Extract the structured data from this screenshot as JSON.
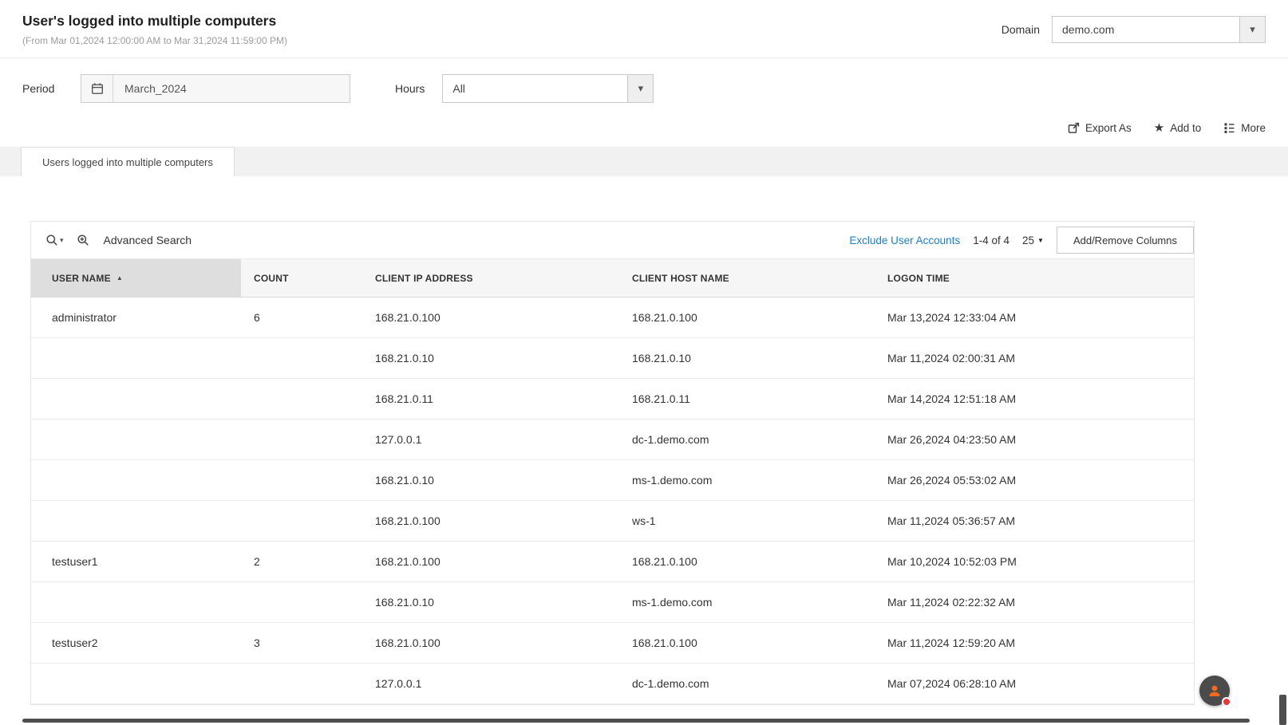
{
  "header": {
    "title": "User's logged into multiple computers",
    "subtitle": "(From Mar 01,2024 12:00:00 AM to Mar 31,2024 11:59:00 PM)",
    "domain_label": "Domain",
    "domain_value": "demo.com"
  },
  "filters": {
    "period_label": "Period",
    "period_value": "March_2024",
    "hours_label": "Hours",
    "hours_value": "All"
  },
  "actions": {
    "export_as": "Export As",
    "add_to": "Add to",
    "more": "More"
  },
  "tabs": [
    {
      "label": "Users logged into multiple computers",
      "active": true
    }
  ],
  "toolbar": {
    "advanced_search": "Advanced Search",
    "exclude_link": "Exclude User Accounts",
    "range_text": "1-4 of 4",
    "page_size": "25",
    "add_remove_columns": "Add/Remove Columns"
  },
  "table": {
    "columns": [
      "USER NAME",
      "COUNT",
      "CLIENT IP ADDRESS",
      "CLIENT HOST NAME",
      "LOGON TIME"
    ],
    "sorted_column": "USER NAME",
    "sort_direction": "asc",
    "rows": [
      [
        "administrator",
        "6",
        "168.21.0.100",
        "168.21.0.100",
        "Mar 13,2024 12:33:04 AM"
      ],
      [
        "",
        "",
        "168.21.0.10",
        "168.21.0.10",
        "Mar 11,2024 02:00:31 AM"
      ],
      [
        "",
        "",
        "168.21.0.11",
        "168.21.0.11",
        "Mar 14,2024 12:51:18 AM"
      ],
      [
        "",
        "",
        "127.0.0.1",
        "dc-1.demo.com",
        "Mar 26,2024 04:23:50 AM"
      ],
      [
        "",
        "",
        "168.21.0.10",
        "ms-1.demo.com",
        "Mar 26,2024 05:53:02 AM"
      ],
      [
        "",
        "",
        "168.21.0.100",
        "ws-1",
        "Mar 11,2024 05:36:57 AM"
      ],
      [
        "testuser1",
        "2",
        "168.21.0.100",
        "168.21.0.100",
        "Mar 10,2024 10:52:03 PM"
      ],
      [
        "",
        "",
        "168.21.0.10",
        "ms-1.demo.com",
        "Mar 11,2024 02:22:32 AM"
      ],
      [
        "testuser2",
        "3",
        "168.21.0.100",
        "168.21.0.100",
        "Mar 11,2024 12:59:20 AM"
      ],
      [
        "",
        "",
        "127.0.0.1",
        "dc-1.demo.com",
        "Mar 07,2024 06:28:10 AM"
      ]
    ]
  },
  "icons": {
    "chevron_down": "▾",
    "sort_asc": "▲",
    "page_size_caret": "▼",
    "star": "★"
  },
  "colors": {
    "link_blue": "#1d7fc0",
    "sorted_header_bg": "#dedede",
    "tab_strip_bg": "#f1f1f1",
    "badge_red": "#e53935"
  }
}
